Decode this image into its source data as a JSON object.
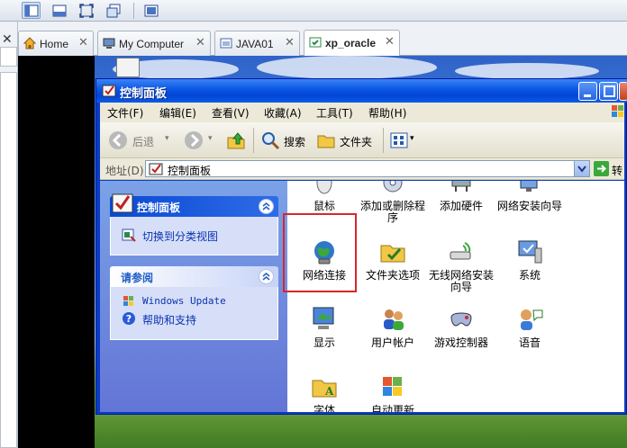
{
  "host": {
    "tabs": [
      {
        "label": "Home",
        "icon": "home-icon",
        "active": false
      },
      {
        "label": "My Computer",
        "icon": "computer-icon",
        "active": false
      },
      {
        "label": "JAVA01",
        "icon": "vm-icon",
        "active": false
      },
      {
        "label": "xp_oracle",
        "icon": "vm-icon",
        "active": true
      }
    ],
    "close_glyph": "✕",
    "left_close_glyph": "✕"
  },
  "window": {
    "title": "控制面板",
    "menu": [
      "文件(F)",
      "编辑(E)",
      "查看(V)",
      "收藏(A)",
      "工具(T)",
      "帮助(H)"
    ],
    "toolbar": {
      "back": "后退",
      "search": "搜索",
      "folders": "文件夹"
    },
    "address": {
      "label": "地址(D)",
      "value": "控制面板",
      "go": "转到"
    }
  },
  "taskpane": {
    "panel1": {
      "title": "控制面板",
      "links": [
        "切换到分类视图"
      ]
    },
    "panel2": {
      "title": "请参阅",
      "links": [
        "Windows Update",
        "帮助和支持"
      ]
    }
  },
  "items": [
    {
      "label": "鼠标",
      "icon": "mouse-icon"
    },
    {
      "label": "添加或删除程序",
      "icon": "add-remove-programs-icon"
    },
    {
      "label": "添加硬件",
      "icon": "add-hardware-icon"
    },
    {
      "label": "网络安装向导",
      "icon": "network-setup-wizard-icon"
    },
    {
      "label": "网络连接",
      "icon": "network-connections-icon"
    },
    {
      "label": "文件夹选项",
      "icon": "folder-options-icon"
    },
    {
      "label": "无线网络安装向导",
      "icon": "wireless-setup-wizard-icon"
    },
    {
      "label": "系统",
      "icon": "system-icon"
    },
    {
      "label": "显示",
      "icon": "display-icon"
    },
    {
      "label": "用户帐户",
      "icon": "user-accounts-icon"
    },
    {
      "label": "游戏控制器",
      "icon": "game-controllers-icon"
    },
    {
      "label": "语音",
      "icon": "speech-icon"
    },
    {
      "label": "字体",
      "icon": "fonts-icon"
    },
    {
      "label": "自动更新",
      "icon": "automatic-updates-icon"
    }
  ]
}
